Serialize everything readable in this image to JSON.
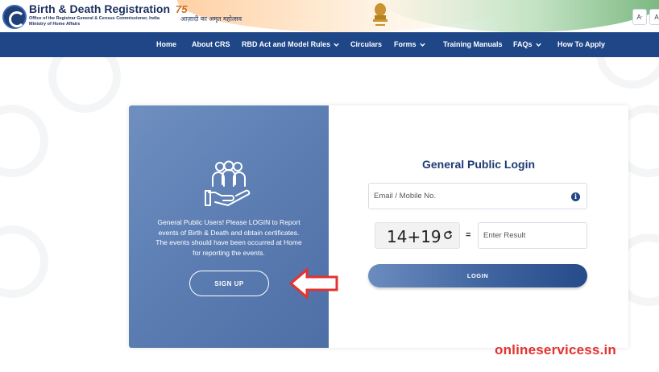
{
  "header": {
    "title": "Birth & Death Registration",
    "subtitle_line1": "Office of the Registrar General & Census Commissioner, India",
    "subtitle_line2": "Ministry of Home Affairs",
    "azadi_number": "75",
    "azadi_text": "आज़ादी का अमृत महोत्सव",
    "font_small": "A",
    "font_normal": "A"
  },
  "nav": {
    "items": [
      {
        "label": "Home",
        "dropdown": false
      },
      {
        "label": "About CRS",
        "dropdown": false
      },
      {
        "label": "RBD Act and Model Rules",
        "dropdown": true
      },
      {
        "label": "Circulars",
        "dropdown": false
      },
      {
        "label": "Forms",
        "dropdown": true
      },
      {
        "label": "Training Manuals",
        "dropdown": false
      },
      {
        "label": "FAQs",
        "dropdown": true
      },
      {
        "label": "How To Apply",
        "dropdown": false
      }
    ]
  },
  "left_panel": {
    "message": "General Public Users! Please LOGIN to Report events of Birth & Death and obtain certificates. The events should have been occurred at Home for reporting the events.",
    "signup_label": "SIGN UP",
    "icon": "people-hand-icon"
  },
  "login": {
    "title": "General Public Login",
    "email_placeholder": "Email / Mobile No.",
    "captcha_text": "14+19",
    "equals": "=",
    "result_placeholder": "Enter Result",
    "login_label": "LOGIN"
  },
  "watermark_text": "onlineservicess.in",
  "colors": {
    "nav_bg": "#1f4788",
    "brand": "#1c2f5e",
    "annotation_red": "#e4322f"
  }
}
